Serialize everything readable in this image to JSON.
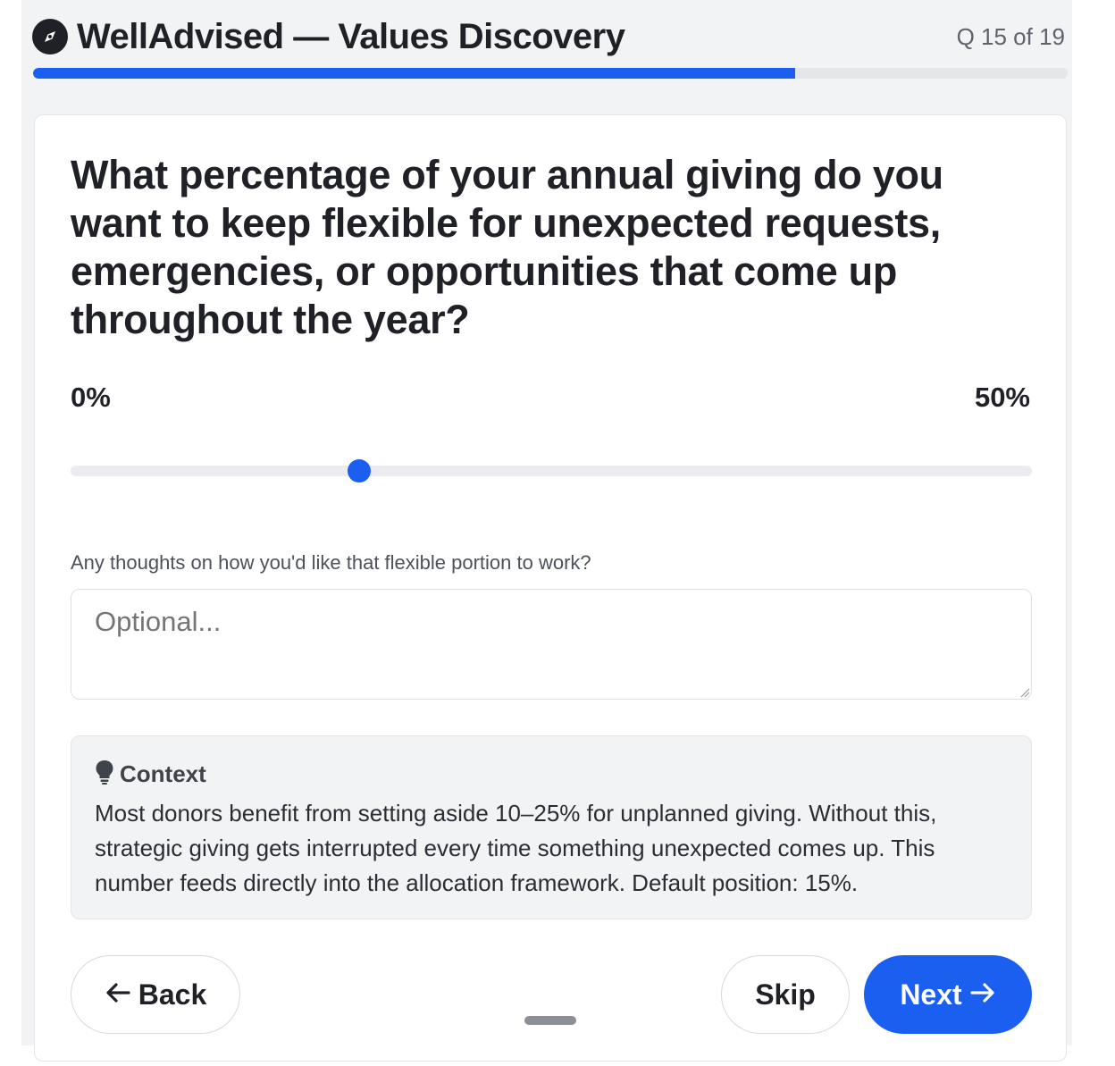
{
  "header": {
    "logo_icon": "compass-icon",
    "title": "WellAdvised — Values Discovery",
    "question_counter": "Q 15 of 19",
    "progress_fraction": 0.737
  },
  "question": {
    "text": "What percentage of your annual giving do you want to keep flexible for unexpected requests, emergencies, or opportunities that come up throughout the year?"
  },
  "slider": {
    "min_label": "0%",
    "max_label": "50%",
    "min": 0,
    "max": 50,
    "value": 15,
    "accent_color": "#1a5ff0"
  },
  "notes": {
    "label": "Any thoughts on how you'd like that flexible portion to work?",
    "placeholder": "Optional...",
    "value": ""
  },
  "context": {
    "icon": "lightbulb-icon",
    "title": "Context",
    "body": "Most donors benefit from setting aside 10–25% for unplanned giving. Without this, strategic giving gets interrupted every time something unexpected comes up. This number feeds directly into the allocation framework. Default position: 15%."
  },
  "navigation": {
    "back_label": "Back",
    "back_icon": "arrow-left-icon",
    "skip_label": "Skip",
    "next_label": "Next",
    "next_icon": "arrow-right-icon",
    "primary_color": "#1a5ff0"
  }
}
